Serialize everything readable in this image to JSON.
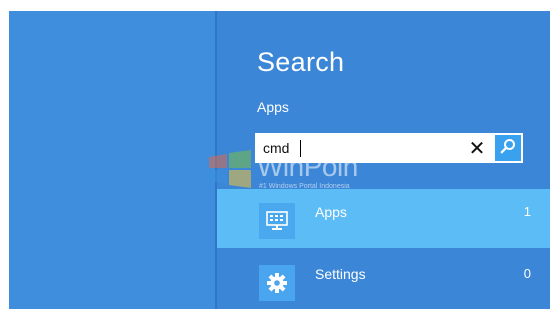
{
  "charm": {
    "title": "Search",
    "scope": "Apps"
  },
  "search": {
    "value": "cmd",
    "clear_glyph": "✕"
  },
  "results": [
    {
      "label": "Apps",
      "count": "1",
      "icon": "app-window-icon"
    },
    {
      "label": "Settings",
      "count": "0",
      "icon": "gear-icon"
    }
  ],
  "watermark": {
    "brand": "WinPoin",
    "tagline": "#1 Windows Portal Indonesia"
  },
  "colors": {
    "background": "#3c88d8",
    "selected_result": "#5cbcf6",
    "search_button": "#3aa1ee"
  }
}
